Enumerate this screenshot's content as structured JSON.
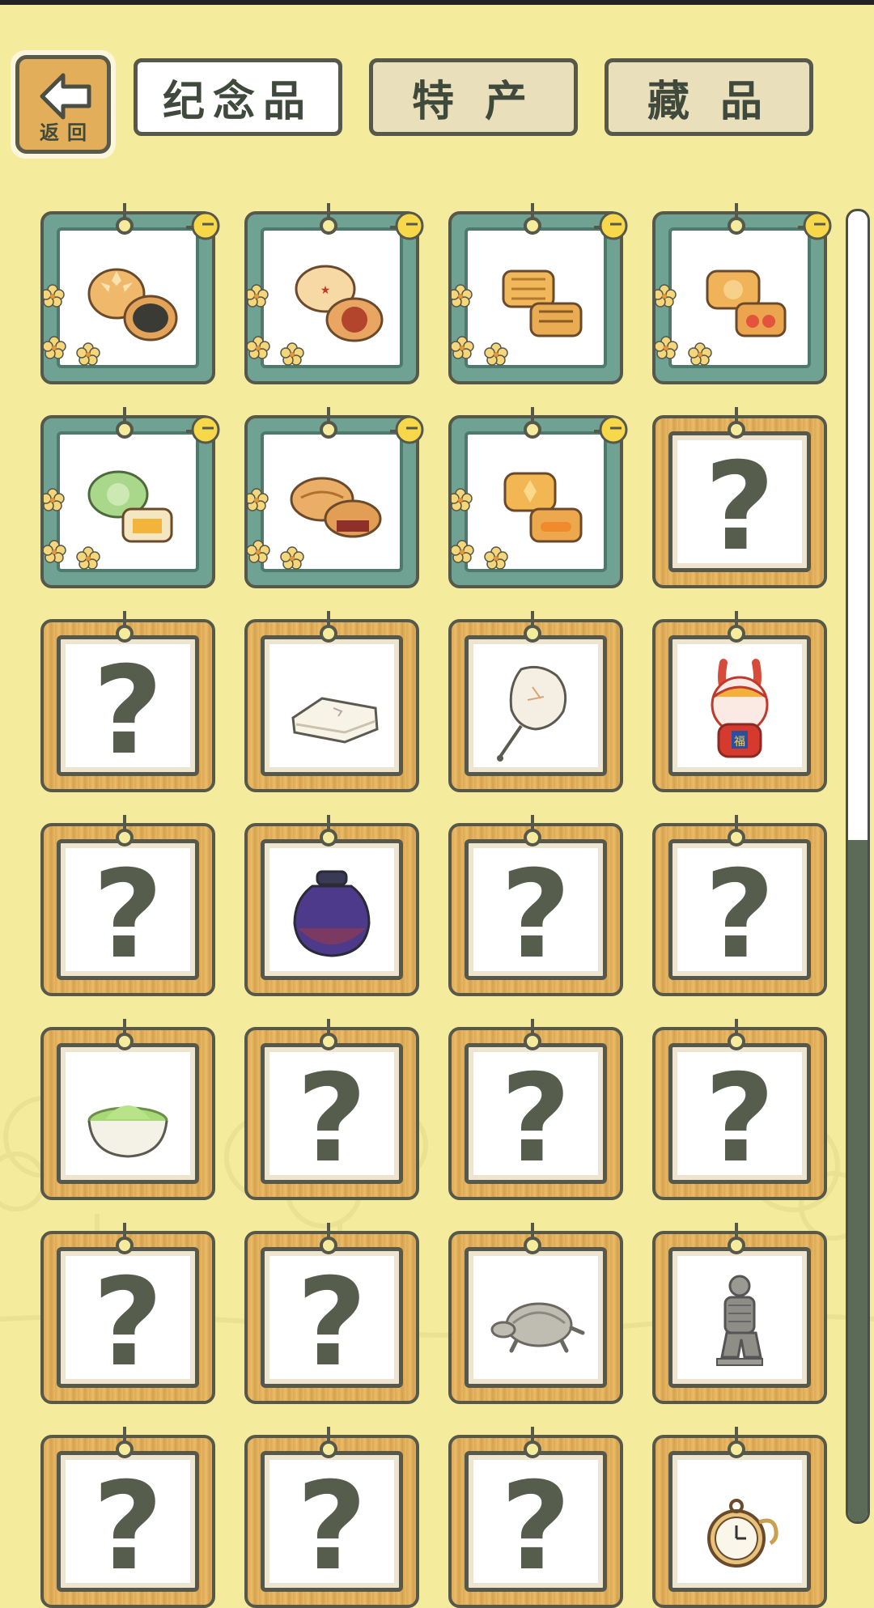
{
  "back": {
    "label": "返回"
  },
  "tabs": [
    {
      "label": "纪念品",
      "active": true
    },
    {
      "label": "特 产",
      "active": false
    },
    {
      "label": "藏 品",
      "active": false
    }
  ],
  "colors": {
    "background": "#f5eb9c",
    "frame_green": "#6fa293",
    "frame_wood": "#dca955",
    "ink": "#3f4a3c"
  },
  "scroll": {
    "position_fraction": 0.0,
    "visible_fraction": 0.52
  },
  "unknown_symbol": "?",
  "items": [
    {
      "kind": "mooncake-sesame",
      "discovered": true,
      "frame": "green"
    },
    {
      "kind": "mooncake-red-stamp",
      "discovered": true,
      "frame": "green"
    },
    {
      "kind": "mooncake-pattern",
      "discovered": true,
      "frame": "green"
    },
    {
      "kind": "mooncake-egg-yolk",
      "discovered": true,
      "frame": "green"
    },
    {
      "kind": "mooncake-green-lotus",
      "discovered": true,
      "frame": "green"
    },
    {
      "kind": "mooncake-red-bean",
      "discovered": true,
      "frame": "green"
    },
    {
      "kind": "mooncake-flower",
      "discovered": true,
      "frame": "green"
    },
    {
      "kind": "unknown",
      "discovered": false,
      "frame": "wood"
    },
    {
      "kind": "unknown",
      "discovered": false,
      "frame": "wood"
    },
    {
      "kind": "folded-cloth",
      "discovered": true,
      "frame": "wood"
    },
    {
      "kind": "silk-fan",
      "discovered": true,
      "frame": "wood"
    },
    {
      "kind": "rabbit-figurine",
      "discovered": true,
      "frame": "wood"
    },
    {
      "kind": "unknown",
      "discovered": false,
      "frame": "wood"
    },
    {
      "kind": "porcelain-jar",
      "discovered": true,
      "frame": "wood"
    },
    {
      "kind": "unknown",
      "discovered": false,
      "frame": "wood"
    },
    {
      "kind": "unknown",
      "discovered": false,
      "frame": "wood"
    },
    {
      "kind": "matcha-bowl",
      "discovered": true,
      "frame": "wood"
    },
    {
      "kind": "unknown",
      "discovered": false,
      "frame": "wood"
    },
    {
      "kind": "unknown",
      "discovered": false,
      "frame": "wood"
    },
    {
      "kind": "unknown",
      "discovered": false,
      "frame": "wood"
    },
    {
      "kind": "unknown",
      "discovered": false,
      "frame": "wood"
    },
    {
      "kind": "unknown",
      "discovered": false,
      "frame": "wood"
    },
    {
      "kind": "stone-turtle",
      "discovered": true,
      "frame": "wood"
    },
    {
      "kind": "terracotta-warrior",
      "discovered": true,
      "frame": "wood"
    },
    {
      "kind": "unknown",
      "discovered": false,
      "frame": "wood"
    },
    {
      "kind": "unknown",
      "discovered": false,
      "frame": "wood"
    },
    {
      "kind": "unknown",
      "discovered": false,
      "frame": "wood"
    },
    {
      "kind": "pocket-watch",
      "discovered": true,
      "frame": "wood"
    }
  ]
}
